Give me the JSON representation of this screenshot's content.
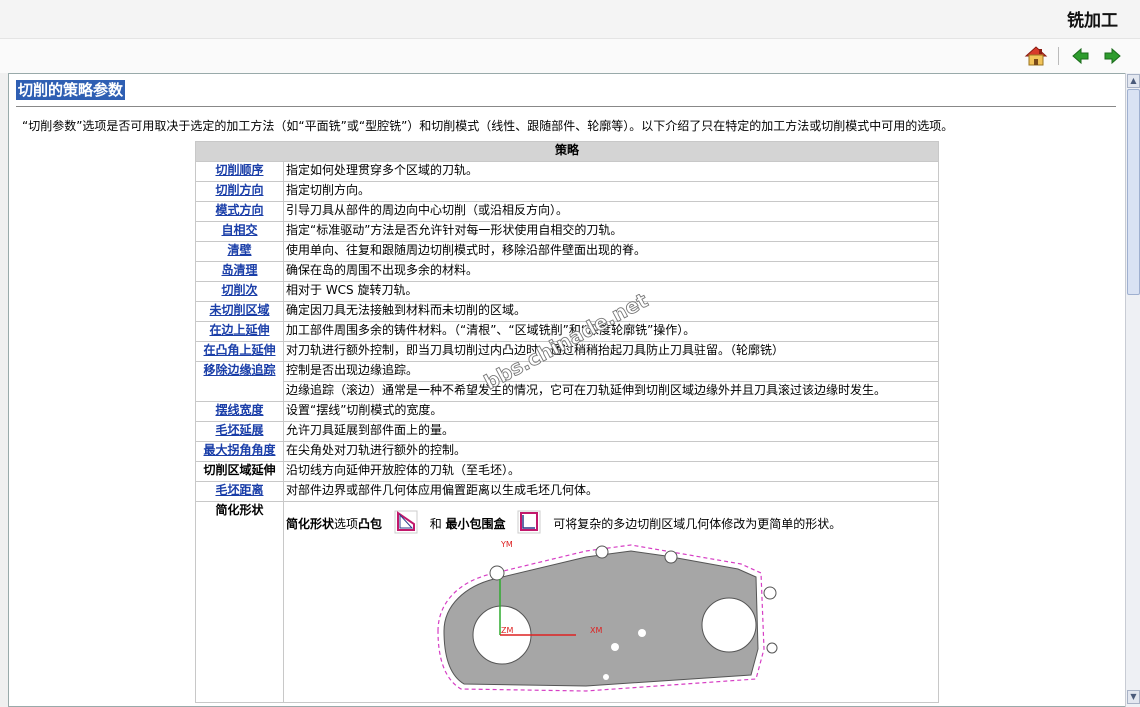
{
  "header": {
    "title": "铣加工"
  },
  "page": {
    "heading": "切削的策略参数",
    "intro": "“切削参数”选项是否可用取决于选定的加工方法（如“平面铣”或“型腔铣”）和切削模式（线性、跟随部件、轮廓等）。以下介绍了只在特定的加工方法或切削模式中可用的选项。",
    "watermark": "bbs.chinade.net"
  },
  "table": {
    "header": "策略",
    "rows": [
      {
        "term": "切削顺序",
        "desc": "指定如何处理贯穿多个区域的刀轨。"
      },
      {
        "term": "切削方向",
        "desc": "指定切削方向。"
      },
      {
        "term": "模式方向",
        "desc": "引导刀具从部件的周边向中心切削（或沿相反方向）。"
      },
      {
        "term": "自相交",
        "desc": "指定“标准驱动”方法是否允许针对每一形状使用自相交的刀轨。"
      },
      {
        "term": "清壁",
        "desc": "使用单向、往复和跟随周边切削模式时，移除沿部件壁面出现的脊。"
      },
      {
        "term": "岛清理",
        "desc": "确保在岛的周围不出现多余的材料。"
      },
      {
        "term": "切削次",
        "desc": "相对于  WCS 旋转刀轨。"
      },
      {
        "term": "未切削区域",
        "desc": "确定因刀具无法接触到材料而未切削的区域。"
      },
      {
        "term": "在边上延伸",
        "desc": "加工部件周围多余的铸件材料。（“清根”、“区域铣削”和“深度轮廓铣”操作）。"
      },
      {
        "term": "在凸角上延伸",
        "desc": "对刀轨进行额外控制，即当刀具切削过内凸边时，通过稍稍抬起刀具防止刀具驻留。（轮廓铣）"
      },
      {
        "term": "移除边缘追踪",
        "desc": "控制是否出现边缘追踪。",
        "desc2": "边缘追踪（滚边）通常是一种不希望发生的情况，它可在刀轨延伸到切削区域边缘外并且刀具滚过该边缘时发生。"
      },
      {
        "term": "摆线宽度",
        "desc": "设置“摆线”切削模式的宽度。"
      },
      {
        "term": "毛坯延展",
        "desc": "允许刀具延展到部件面上的量。"
      },
      {
        "term": "最大拐角角度",
        "desc": "在尖角处对刀轨进行额外的控制。"
      },
      {
        "term": "切削区域延伸",
        "desc": "沿切线方向延伸开放腔体的刀轨（至毛坯）。",
        "plain": true
      },
      {
        "term": "毛坯距离",
        "desc": "对部件边界或部件几何体应用偏置距离以生成毛坯几何体。"
      }
    ],
    "simplify": {
      "term": "简化形状",
      "t1": "简化形状",
      "t2": "选项",
      "t3": "凸包",
      "t4": "和",
      "t5": "最小包围盒",
      "t6": "可将复杂的多边切削区域几何体修改为更简单的形状。"
    },
    "drawing_labels": {
      "ym": "YM",
      "zm": "ZM",
      "xm": "XM"
    }
  },
  "colors": {
    "link": "#1a3ea8",
    "heading_bg": "#2f5fb3",
    "table_header": "#d4d4d4",
    "nav_arrow": "#2e9c2e",
    "part": "#a6a6a6"
  },
  "icons": {
    "home": "home-icon",
    "back": "back-arrow-icon",
    "forward": "forward-arrow-icon"
  }
}
